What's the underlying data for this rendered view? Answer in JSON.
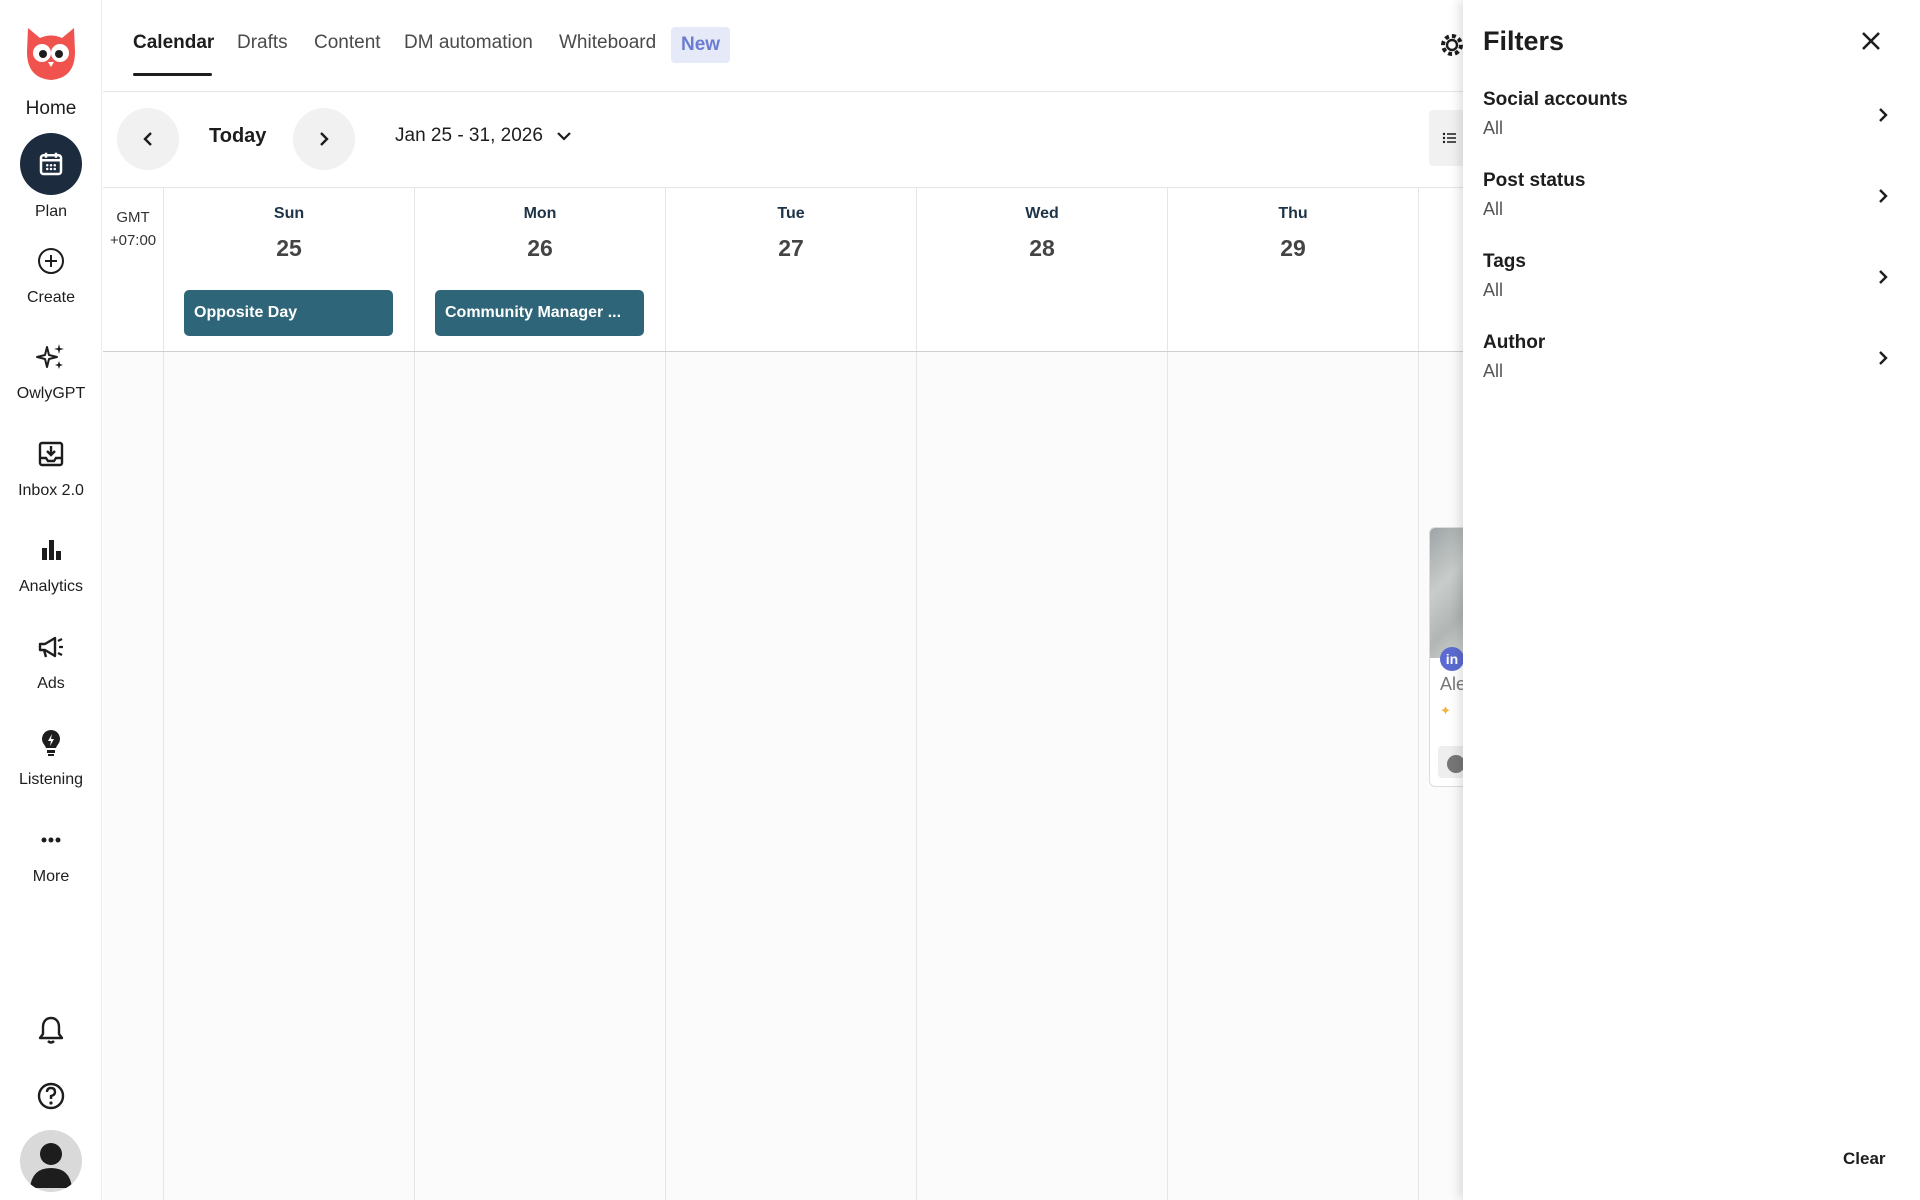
{
  "nav": {
    "home_label": "Home",
    "items": [
      {
        "label": "Plan",
        "icon": "calendar-icon"
      },
      {
        "label": "Create",
        "icon": "plus-circle-icon"
      },
      {
        "label": "OwlyGPT",
        "icon": "sparkles-icon"
      },
      {
        "label": "Inbox 2.0",
        "icon": "inbox-icon"
      },
      {
        "label": "Analytics",
        "icon": "bar-chart-icon"
      },
      {
        "label": "Ads",
        "icon": "megaphone-icon"
      },
      {
        "label": "Listening",
        "icon": "lightbulb-icon"
      },
      {
        "label": "More",
        "icon": "ellipsis-icon"
      }
    ],
    "bottom_icons": [
      "bell-icon",
      "help-icon",
      "avatar"
    ]
  },
  "tabs": {
    "items": [
      "Calendar",
      "Drafts",
      "Content",
      "DM automation",
      "Whiteboard"
    ],
    "active": "Calendar",
    "new_badge": "New"
  },
  "toolbar": {
    "today": "Today",
    "date_range": "Jan 25 - 31, 2026"
  },
  "calendar": {
    "timezone_line1": "GMT",
    "timezone_line2": "+07:00",
    "days": [
      {
        "name": "Sun",
        "num": "25",
        "event": "Opposite Day"
      },
      {
        "name": "Mon",
        "num": "26",
        "event": "Community Manager ..."
      },
      {
        "name": "Tue",
        "num": "27",
        "event": ""
      },
      {
        "name": "Wed",
        "num": "28",
        "event": ""
      },
      {
        "name": "Thu",
        "num": "29",
        "event": ""
      }
    ],
    "post_card": {
      "network": "in",
      "author_partial": "Ale"
    }
  },
  "filters": {
    "title": "Filters",
    "rows": [
      {
        "label": "Social accounts",
        "value": "All"
      },
      {
        "label": "Post status",
        "value": "All"
      },
      {
        "label": "Tags",
        "value": "All"
      },
      {
        "label": "Author",
        "value": "All"
      }
    ],
    "clear": "Clear"
  },
  "colors": {
    "brand": "#f0524d",
    "nav_active": "#1c2b3d",
    "event": "#2f6578",
    "new_badge_bg": "#e6e9f7",
    "new_badge_text": "#6b7dd0"
  }
}
